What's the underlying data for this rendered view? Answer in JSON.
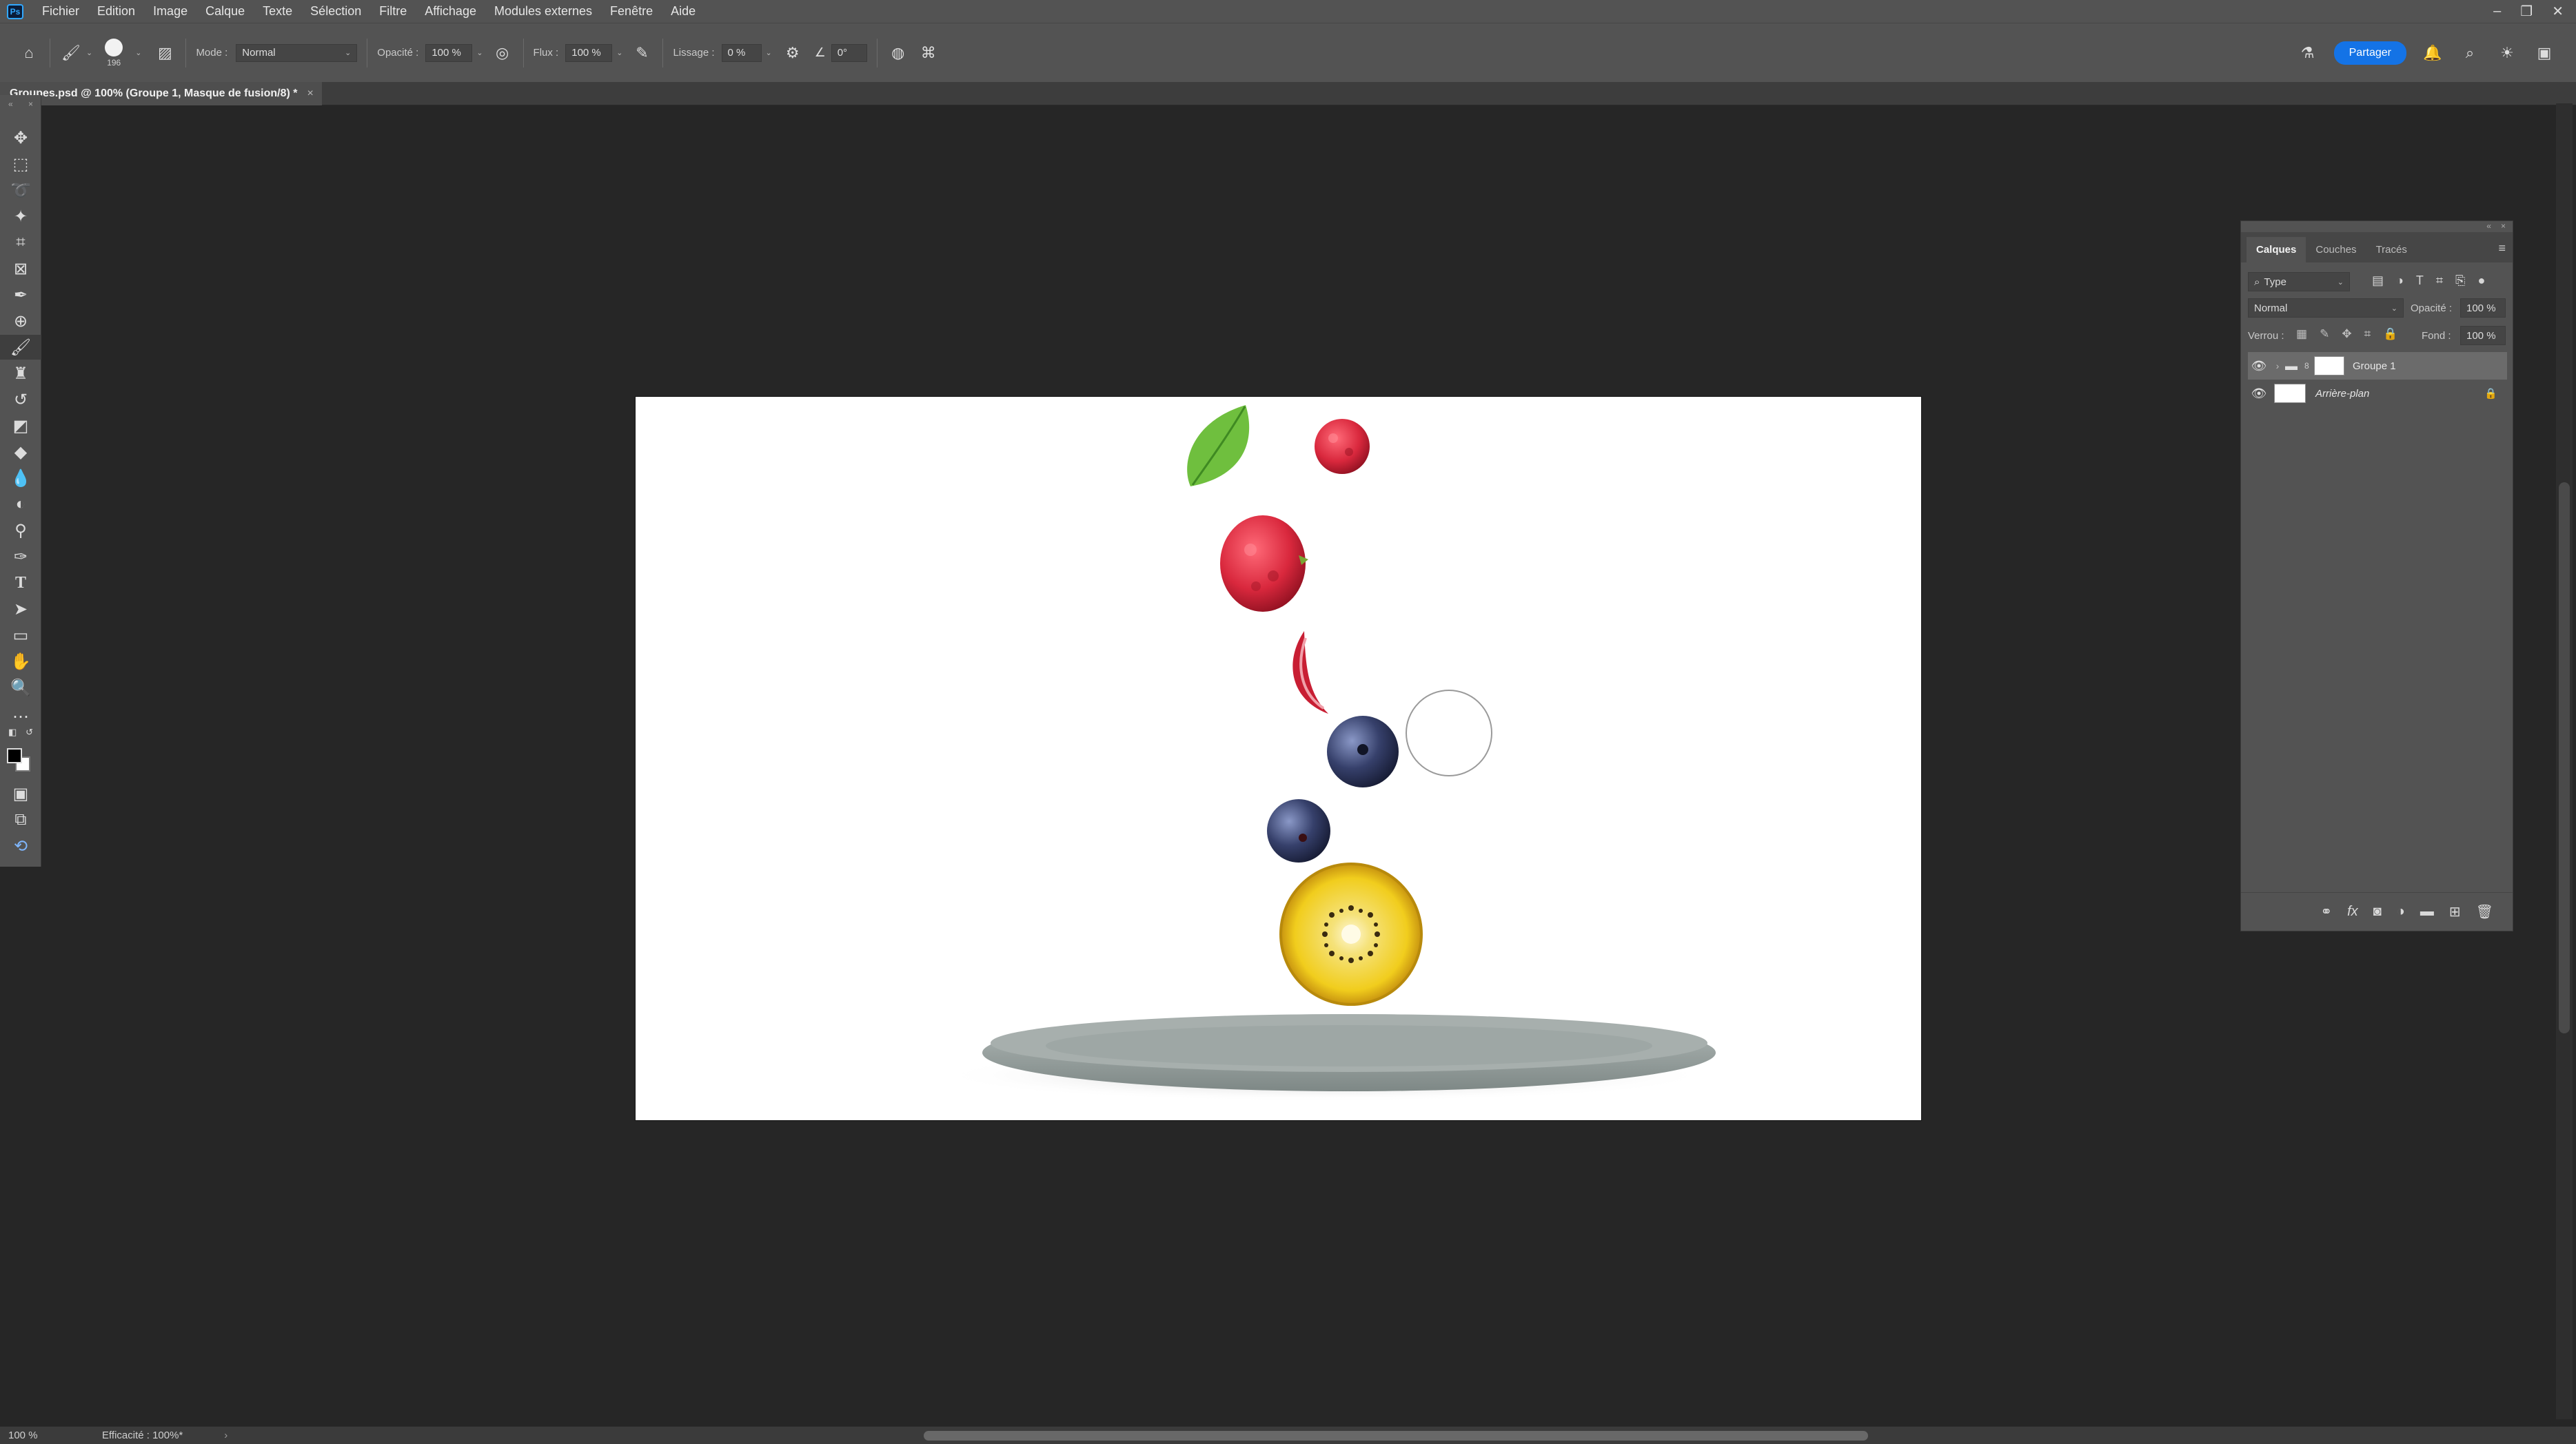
{
  "menu": {
    "logo": "Ps",
    "items": [
      "Fichier",
      "Edition",
      "Image",
      "Calque",
      "Texte",
      "Sélection",
      "Filtre",
      "Affichage",
      "Modules externes",
      "Fenêtre",
      "Aide"
    ]
  },
  "options": {
    "brush_size": "196",
    "mode_label": "Mode :",
    "mode_value": "Normal",
    "opacity_label": "Opacité :",
    "opacity_value": "100 %",
    "flow_label": "Flux :",
    "flow_value": "100 %",
    "smoothing_label": "Lissage :",
    "smoothing_value": "0 %",
    "angle_value": "0°",
    "share_label": "Partager"
  },
  "document": {
    "tab_title": "Groupes.psd @ 100% (Groupe 1, Masque de fusion/8) *",
    "close": "×"
  },
  "layers_panel": {
    "tabs": [
      "Calques",
      "Couches",
      "Tracés"
    ],
    "filter_value": "Type",
    "blend_mode": "Normal",
    "opacity_label": "Opacité :",
    "opacity_value": "100 %",
    "lock_label": "Verrou :",
    "fill_label": "Fond :",
    "fill_value": "100 %",
    "layers": [
      {
        "name": "Groupe 1",
        "type": "group",
        "selected": true
      },
      {
        "name": "Arrière-plan",
        "type": "background",
        "locked": true
      }
    ]
  },
  "status": {
    "zoom": "100 %",
    "info": "Efficacité : 100%*"
  },
  "colors": {
    "accent": "#1473e6",
    "ui_panel": "#535353",
    "workspace": "#262626"
  }
}
